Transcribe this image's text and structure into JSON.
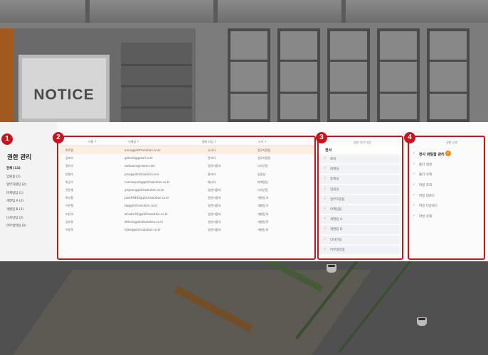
{
  "background": {
    "notice_sign": "NOTICE"
  },
  "sidebar": {
    "title": "권한 관리",
    "items": [
      {
        "label": "전체 (11)",
        "active": true
      },
      {
        "label": "임원실 (1)"
      },
      {
        "label": "업무지원팀 (2)"
      },
      {
        "label": "마케팅팀 (1)"
      },
      {
        "label": "개발팀 A (2)"
      },
      {
        "label": "개발팀 B (3)"
      },
      {
        "label": "디자인팀 (2)"
      },
      {
        "label": "미부협력실 (0)"
      }
    ]
  },
  "badges": [
    "1",
    "2",
    "3",
    "4"
  ],
  "member_table": {
    "columns": [
      "이름 ↑",
      "이메일 ↑",
      "멤버 타입 ↑",
      "소속 ↑"
    ],
    "rows": [
      [
        "박주환",
        "anna@pitchsolution.co.kr",
        "소유자",
        "업무지원팀"
      ],
      [
        "김포터",
        "girlsoid@gmail.com",
        "관리자",
        "업무지원팀"
      ],
      [
        "정유미",
        "owhoooo@naver.com",
        "일반사용자",
        "디자인팀"
      ],
      [
        "안명수",
        "jsan@pitchsolution.co.kr",
        "관리자",
        "임원실"
      ],
      [
        "박공수",
        "connorpark@pitchsolution.co.kr",
        "매니저",
        "마케팅팀"
      ],
      [
        "전윤재",
        "ymjeon@pitchsolution.co.kr",
        "일반사용자",
        "디자인팀"
      ],
      [
        "박성철",
        "park90403@pitchsolution.co.kr",
        "일반사용자",
        "개발팀 A"
      ],
      [
        "이은철",
        "lwj@pitchsolution.co.kr",
        "일반사용자",
        "개발팀 A"
      ],
      [
        "조은비",
        "whsdnrlr1@pitchsolution.co.kr",
        "일반사용자",
        "개발팀 B"
      ],
      [
        "김지현",
        "dhkms@pitchsolution.co.kr",
        "일반사용자",
        "개발팀 B"
      ],
      [
        "이동혁",
        "hjlee@pitchsolution.co.kr",
        "일반사용자",
        "개발팀 B"
      ]
    ],
    "selected_row": 0
  },
  "permission_targets": {
    "title": "권한 부여 대상",
    "items": [
      "전사",
      "로비",
      "회계실",
      "총계실",
      "임원실",
      "업무지원팀",
      "마케팅팀",
      "개발팀 A",
      "개발팀 B",
      "디자인팀",
      "미부협력실"
    ]
  },
  "permission_detail": {
    "title": "권한 상세",
    "items": [
      "전사 파일함 관리",
      "폴더 생성",
      "폴더 삭제",
      "파일 조회",
      "파일 업로드",
      "파일 다운로드",
      "파일 삭제"
    ],
    "highlight_check": "✓"
  },
  "colors": {
    "accent_red": "#c8141c",
    "check_orange": "#e08a3c",
    "selected_row_bg": "#fdeee2"
  },
  "icons": {
    "check": "✓"
  }
}
